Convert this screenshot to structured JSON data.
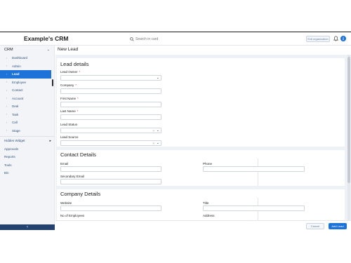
{
  "header": {
    "brand": "Example's  CRM",
    "search_placeholder": "Search in card",
    "exit_label": "Exit organization"
  },
  "sidebar": {
    "section_title": "CRM",
    "items": [
      {
        "label": "Dashboard",
        "active": false
      },
      {
        "label": "Admin",
        "active": false
      },
      {
        "label": "Lead",
        "active": true
      },
      {
        "label": "Employee",
        "active": false
      },
      {
        "label": "Contact",
        "active": false
      },
      {
        "label": "Account",
        "active": false
      },
      {
        "label": "Deal",
        "active": false
      },
      {
        "label": "Task",
        "active": false
      },
      {
        "label": "Call",
        "active": false
      },
      {
        "label": "Stage",
        "active": false
      }
    ],
    "top_items": [
      {
        "label": "Hidden Widget",
        "has_arrow": true
      },
      {
        "label": "Approvals",
        "has_arrow": false
      },
      {
        "label": "Reports",
        "has_arrow": false
      },
      {
        "label": "Tools",
        "has_arrow": false
      },
      {
        "label": "Bin",
        "has_arrow": false
      }
    ],
    "collapse_icon": "chevron-left-icon"
  },
  "main": {
    "page_title": "New Lead",
    "lead_details": {
      "title": "Lead details",
      "fields": {
        "lead_owner": "Lead Owner",
        "company": "Company",
        "first_name": "First Name",
        "last_name": "Last Name",
        "lead_status": "Lead Status",
        "lead_source": "Lead Source"
      }
    },
    "contact_details": {
      "title": "Contact Details",
      "fields": {
        "email": "Email",
        "phone": "Phone",
        "secondary_email": "Secondary Email"
      }
    },
    "company_details": {
      "title": "Company Details",
      "fields": {
        "website": "Website",
        "title": "Title",
        "employees": "No of Employees",
        "address": "Address"
      }
    }
  },
  "footer": {
    "cancel_label": "Cancel",
    "add_label": "Add Lead"
  },
  "colors": {
    "accent": "#1d73d8",
    "sidebar_bottom": "#24426e",
    "required": "#d63a3a"
  }
}
